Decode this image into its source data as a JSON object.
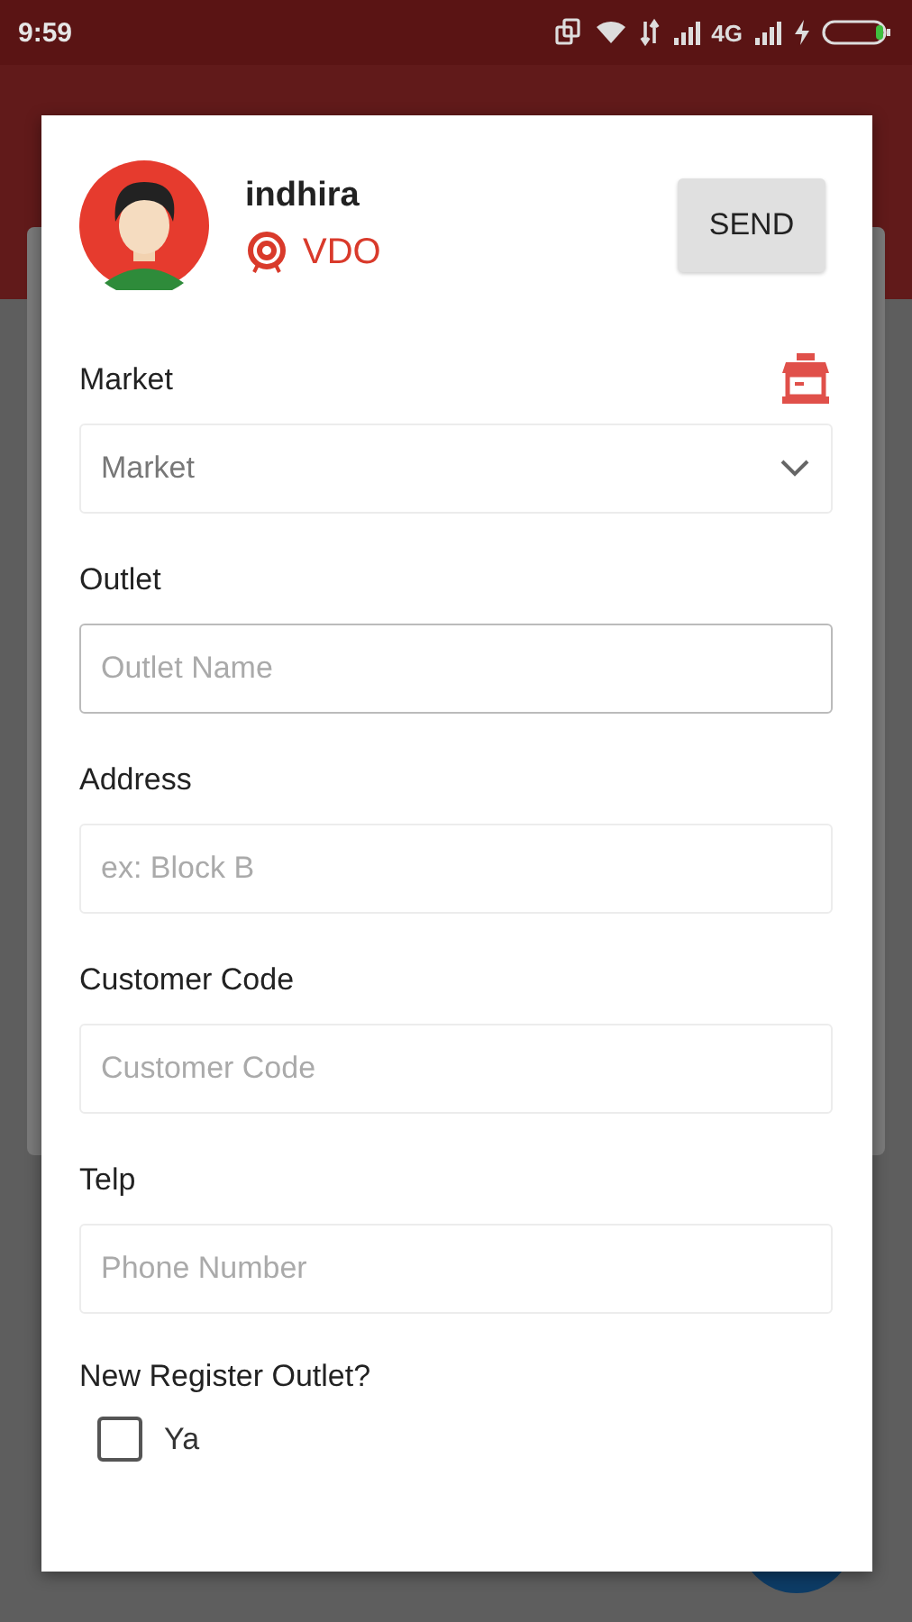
{
  "status_bar": {
    "time": "9:59",
    "network": "4G"
  },
  "dialog": {
    "user": {
      "name": "indhira",
      "role": "VDO"
    },
    "send_button": "SEND",
    "fields": [
      {
        "kind": "select",
        "label": "Market",
        "value": "Market",
        "focused": false
      },
      {
        "kind": "text",
        "label": "Outlet",
        "placeholder": "Outlet Name",
        "focused": true
      },
      {
        "kind": "text",
        "label": "Address",
        "placeholder": "ex: Block B",
        "focused": false
      },
      {
        "kind": "text",
        "label": "Customer Code",
        "placeholder": "Customer Code",
        "focused": false
      },
      {
        "kind": "text",
        "label": "Telp",
        "placeholder": "Phone Number",
        "focused": false
      }
    ],
    "question": {
      "label": "New Register Outlet?",
      "options": [
        {
          "label": "Ya",
          "checked": false
        }
      ]
    }
  }
}
